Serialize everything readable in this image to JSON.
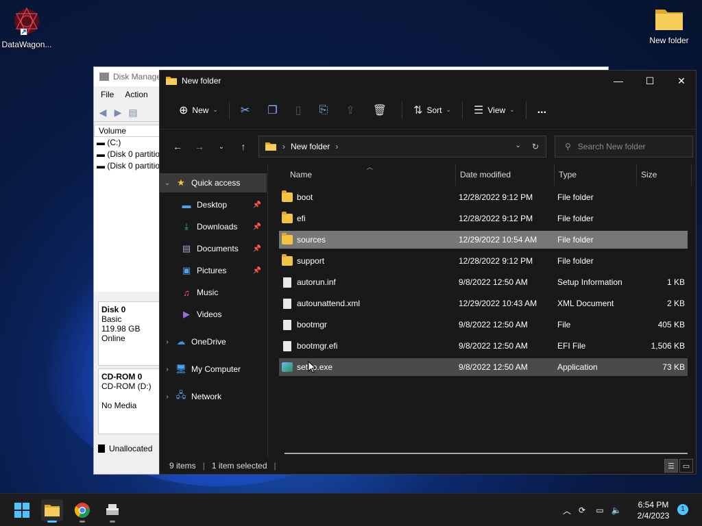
{
  "desktop": {
    "icons": [
      {
        "label": "DataWagon..."
      },
      {
        "label": "New folder"
      }
    ]
  },
  "disk_mgmt": {
    "title": "Disk Manage",
    "menu": [
      "File",
      "Action"
    ],
    "volume_header": "Volume",
    "volumes": [
      "(C:)",
      "(Disk 0 partitio",
      "(Disk 0 partitio"
    ],
    "disk0": {
      "name": "Disk 0",
      "type": "Basic",
      "size": "119.98 GB",
      "status": "Online"
    },
    "cdrom": {
      "name": "CD-ROM 0",
      "drive": "CD-ROM (D:)",
      "media": "No Media"
    },
    "legend": "Unallocated"
  },
  "explorer": {
    "title": "New folder",
    "toolbar": {
      "new": "New",
      "sort": "Sort",
      "view": "View",
      "more": "..."
    },
    "address": {
      "crumb": "New folder"
    },
    "search": {
      "placeholder": "Search New folder"
    },
    "nav": {
      "quick_access": "Quick access",
      "items": [
        "Desktop",
        "Downloads",
        "Documents",
        "Pictures",
        "Music",
        "Videos"
      ],
      "onedrive": "OneDrive",
      "my_computer": "My Computer",
      "network": "Network"
    },
    "columns": {
      "name": "Name",
      "date": "Date modified",
      "type": "Type",
      "size": "Size"
    },
    "files": [
      {
        "name": "boot",
        "date": "12/28/2022 9:12 PM",
        "type": "File folder",
        "size": ""
      },
      {
        "name": "efi",
        "date": "12/28/2022 9:12 PM",
        "type": "File folder",
        "size": ""
      },
      {
        "name": "sources",
        "date": "12/29/2022 10:54 AM",
        "type": "File folder",
        "size": ""
      },
      {
        "name": "support",
        "date": "12/28/2022 9:12 PM",
        "type": "File folder",
        "size": ""
      },
      {
        "name": "autorun.inf",
        "date": "9/8/2022 12:50 AM",
        "type": "Setup Information",
        "size": "1 KB"
      },
      {
        "name": "autounattend.xml",
        "date": "12/29/2022 10:43 AM",
        "type": "XML Document",
        "size": "2 KB"
      },
      {
        "name": "bootmgr",
        "date": "9/8/2022 12:50 AM",
        "type": "File",
        "size": "405 KB"
      },
      {
        "name": "bootmgr.efi",
        "date": "9/8/2022 12:50 AM",
        "type": "EFI File",
        "size": "1,506 KB"
      },
      {
        "name": "setup.exe",
        "date": "9/8/2022 12:50 AM",
        "type": "Application",
        "size": "73 KB"
      }
    ],
    "status": {
      "count": "9 items",
      "selected": "1 item selected"
    }
  },
  "taskbar": {
    "time": "6:54 PM",
    "date": "2/4/2023",
    "notifications": "1"
  },
  "colors": {
    "accent": "#4cc2ff",
    "folder": "#f3c444",
    "explorer_bg": "#191919"
  }
}
